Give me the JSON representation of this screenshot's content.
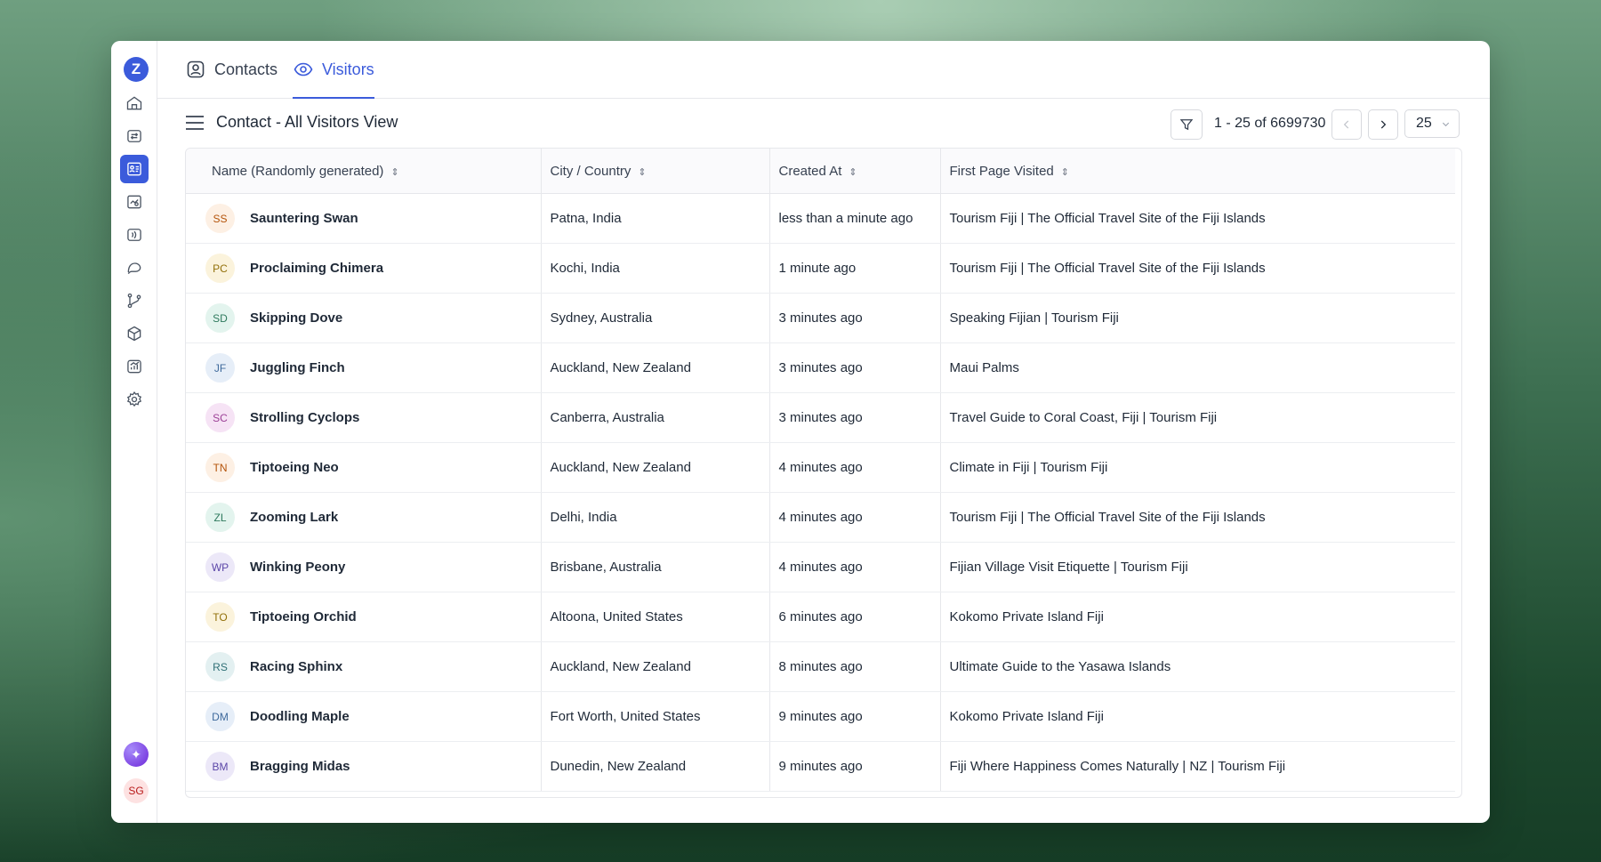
{
  "app": {
    "logo_letter": "Z"
  },
  "tabs": [
    {
      "label": "Contacts",
      "active": false
    },
    {
      "label": "Visitors",
      "active": true
    }
  ],
  "user": {
    "initials": "SG"
  },
  "toolbar": {
    "view_title": "Contact - All Visitors View",
    "pagination_text": "1 - 25 of 6699730",
    "page_size": "25",
    "prev": "<",
    "next": ">"
  },
  "table": {
    "columns": [
      "Name (Randomly generated)",
      "City / Country",
      "Created At",
      "First Page Visited"
    ],
    "rows": [
      {
        "initials": "SS",
        "name": "Sauntering Swan",
        "city": "Patna, India",
        "created": "less than a minute ago",
        "page": "Tourism Fiji | The Official Travel Site of the Fiji Islands",
        "bg": "#fdf0e4",
        "fg": "#b45309"
      },
      {
        "initials": "PC",
        "name": "Proclaiming Chimera",
        "city": "Kochi, India",
        "created": "1 minute ago",
        "page": "Tourism Fiji | The Official Travel Site of the Fiji Islands",
        "bg": "#fbf3dc",
        "fg": "#92700a"
      },
      {
        "initials": "SD",
        "name": "Skipping Dove",
        "city": "Sydney, Australia",
        "created": "3 minutes ago",
        "page": "Speaking Fijian | Tourism Fiji",
        "bg": "#e3f4ee",
        "fg": "#2f7a5e"
      },
      {
        "initials": "JF",
        "name": "Juggling Finch",
        "city": "Auckland, New Zealand",
        "created": "3 minutes ago",
        "page": "Maui Palms",
        "bg": "#e6eef8",
        "fg": "#3f6a9c"
      },
      {
        "initials": "SC",
        "name": "Strolling Cyclops",
        "city": "Canberra, Australia",
        "created": "3 minutes ago",
        "page": "Travel Guide to Coral Coast, Fiji | Tourism Fiji",
        "bg": "#f6e3f5",
        "fg": "#9c3f96"
      },
      {
        "initials": "TN",
        "name": "Tiptoeing Neo",
        "city": "Auckland, New Zealand",
        "created": "4 minutes ago",
        "page": "Climate in Fiji | Tourism Fiji",
        "bg": "#fdf0e4",
        "fg": "#b45309"
      },
      {
        "initials": "ZL",
        "name": "Zooming Lark",
        "city": "Delhi, India",
        "created": "4 minutes ago",
        "page": "Tourism Fiji | The Official Travel Site of the Fiji Islands",
        "bg": "#e3f4ee",
        "fg": "#2f7a5e"
      },
      {
        "initials": "WP",
        "name": "Winking Peony",
        "city": "Brisbane, Australia",
        "created": "4 minutes ago",
        "page": "Fijian Village Visit Etiquette | Tourism Fiji",
        "bg": "#ece8f8",
        "fg": "#5b46a8"
      },
      {
        "initials": "TO",
        "name": "Tiptoeing Orchid",
        "city": "Altoona, United States",
        "created": "6 minutes ago",
        "page": "Kokomo Private Island Fiji",
        "bg": "#fbf3dc",
        "fg": "#92700a"
      },
      {
        "initials": "RS",
        "name": "Racing Sphinx",
        "city": "Auckland, New Zealand",
        "created": "8 minutes ago",
        "page": "Ultimate Guide to the Yasawa Islands",
        "bg": "#e3f0f1",
        "fg": "#2f6f75"
      },
      {
        "initials": "DM",
        "name": "Doodling Maple",
        "city": "Fort Worth, United States",
        "created": "9 minutes ago",
        "page": "Kokomo Private Island Fiji",
        "bg": "#e6eef8",
        "fg": "#3f6a9c"
      },
      {
        "initials": "BM",
        "name": "Bragging Midas",
        "city": "Dunedin, New Zealand",
        "created": "9 minutes ago",
        "page": "Fiji Where Happiness Comes Naturally | NZ | Tourism Fiji",
        "bg": "#ece8f8",
        "fg": "#5b46a8"
      }
    ]
  }
}
